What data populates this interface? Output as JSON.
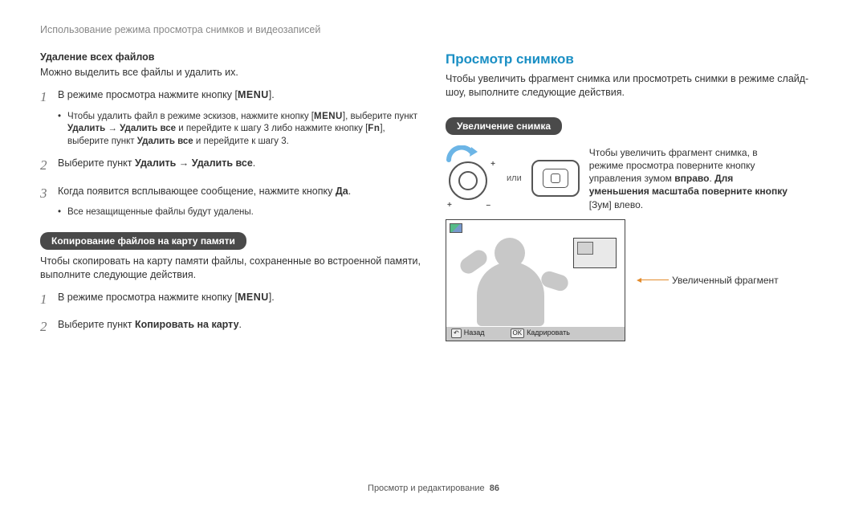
{
  "header": "Использование режима просмотра снимков и видеозаписей",
  "left": {
    "heading_delete_all": "Удаление всех файлов",
    "delete_intro": "Можно выделить все файлы и удалить их.",
    "menu_word": "MENU",
    "fn_word": "Fn",
    "step1_pre": "В режиме просмотра нажмите кнопку [",
    "step1_post": "].",
    "bullet1_a": "Чтобы удалить файл в режиме эскизов, нажмите кнопку [",
    "bullet1_b": "], выберите пункт ",
    "bullet1_c": "Удалить",
    "arrow": " → ",
    "bullet1_d": "Удалить все",
    "bullet1_e": " и перейдите к шагу 3 либо нажмите кнопку [",
    "bullet1_f": "], выберите пункт ",
    "bullet1_g": "Удалить все",
    "bullet1_h": " и перейдите к шагу 3.",
    "step2_a": "Выберите пункт ",
    "step2_b": "Удалить",
    "step2_c": " → ",
    "step2_d": "Удалить все",
    "step2_e": ".",
    "step3_a": "Когда появится всплывающее сообщение, нажмите кнопку ",
    "step3_b": "Да",
    "step3_c": ".",
    "bullet3": "Все незащищенные файлы будут удалены.",
    "pill_copy": "Копирование файлов на карту памяти",
    "copy_intro": "Чтобы скопировать на карту памяти файлы, сохраненные во встроенной памяти, выполните следующие действия.",
    "copy_step1_pre": "В режиме просмотра нажмите кнопку [",
    "copy_step1_post": "].",
    "copy_step2_a": "Выберите пункт ",
    "copy_step2_b": "Копировать на карту",
    "copy_step2_c": "."
  },
  "right": {
    "title": "Просмотр снимков",
    "intro": "Чтобы увеличить фрагмент снимка или просмотреть снимки в режиме слайд-шоу, выполните следующие действия.",
    "pill_zoom": "Увеличение снимка",
    "or": "или",
    "zoom_a": "Чтобы увеличить фрагмент снимка, в режиме просмотра поверните кнопку управления зумом ",
    "zoom_b": "вправо",
    "zoom_c": ". ",
    "zoom_d": "Для уменьшения масштаба поверните кнопку",
    "zoom_e": " [Зум] влево.",
    "leader": "Увеличенный фрагмент",
    "bar_back": "Назад",
    "bar_crop": "Кадрировать",
    "bar_btn_back": "↶",
    "bar_btn_ok": "OK"
  },
  "footer": {
    "text": "Просмотр и редактирование",
    "page": "86"
  }
}
